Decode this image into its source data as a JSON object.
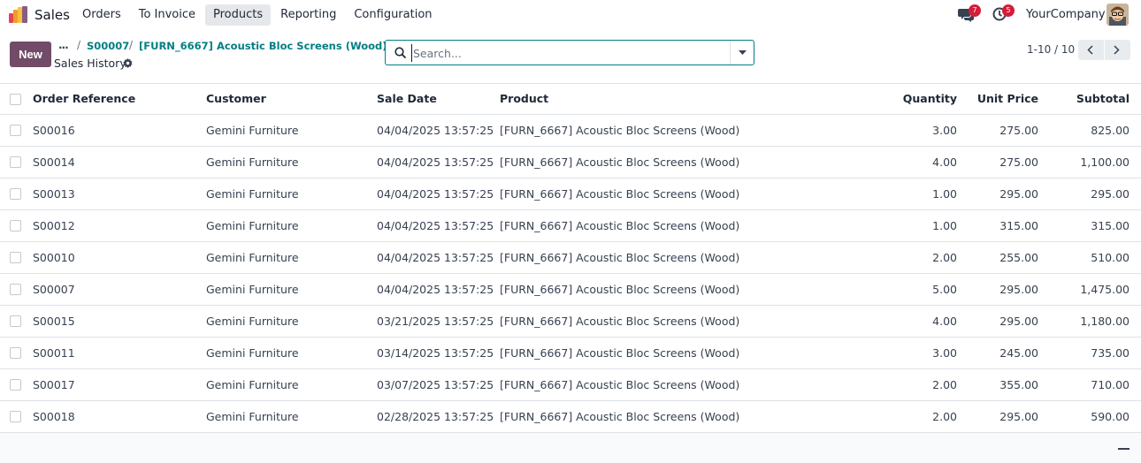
{
  "navbar": {
    "app_name": "Sales",
    "menu": [
      "Orders",
      "To Invoice",
      "Products",
      "Reporting",
      "Configuration"
    ],
    "active_menu": "Products",
    "messages_count": "7",
    "activities_count": "5",
    "company": "YourCompany"
  },
  "control": {
    "new_label": "New",
    "breadcrumb_ellipsis": "...",
    "breadcrumbs": [
      "S00007",
      "[FURN_6667] Acoustic Bloc Screens (Wood)"
    ],
    "page_title": "Sales History",
    "search_placeholder": "Search...",
    "pager": "1-10 / 10"
  },
  "table": {
    "columns": [
      "Order Reference",
      "Customer",
      "Sale Date",
      "Product",
      "Quantity",
      "Unit Price",
      "Subtotal"
    ],
    "rows": [
      [
        "S00016",
        "Gemini Furniture",
        "04/04/2025 13:57:25",
        "[FURN_6667] Acoustic Bloc Screens (Wood)",
        "3.00",
        "275.00",
        "825.00"
      ],
      [
        "S00014",
        "Gemini Furniture",
        "04/04/2025 13:57:25",
        "[FURN_6667] Acoustic Bloc Screens (Wood)",
        "4.00",
        "275.00",
        "1,100.00"
      ],
      [
        "S00013",
        "Gemini Furniture",
        "04/04/2025 13:57:25",
        "[FURN_6667] Acoustic Bloc Screens (Wood)",
        "1.00",
        "295.00",
        "295.00"
      ],
      [
        "S00012",
        "Gemini Furniture",
        "04/04/2025 13:57:25",
        "[FURN_6667] Acoustic Bloc Screens (Wood)",
        "1.00",
        "315.00",
        "315.00"
      ],
      [
        "S00010",
        "Gemini Furniture",
        "04/04/2025 13:57:25",
        "[FURN_6667] Acoustic Bloc Screens (Wood)",
        "2.00",
        "255.00",
        "510.00"
      ],
      [
        "S00007",
        "Gemini Furniture",
        "04/04/2025 13:57:25",
        "[FURN_6667] Acoustic Bloc Screens (Wood)",
        "5.00",
        "295.00",
        "1,475.00"
      ],
      [
        "S00015",
        "Gemini Furniture",
        "03/21/2025 13:57:25",
        "[FURN_6667] Acoustic Bloc Screens (Wood)",
        "4.00",
        "295.00",
        "1,180.00"
      ],
      [
        "S00011",
        "Gemini Furniture",
        "03/14/2025 13:57:25",
        "[FURN_6667] Acoustic Bloc Screens (Wood)",
        "3.00",
        "245.00",
        "735.00"
      ],
      [
        "S00017",
        "Gemini Furniture",
        "03/07/2025 13:57:25",
        "[FURN_6667] Acoustic Bloc Screens (Wood)",
        "2.00",
        "355.00",
        "710.00"
      ],
      [
        "S00018",
        "Gemini Furniture",
        "02/28/2025 13:57:25",
        "[FURN_6667] Acoustic Bloc Screens (Wood)",
        "2.00",
        "295.00",
        "590.00"
      ]
    ]
  },
  "colors": {
    "brand": "#714b67",
    "link": "#017e84",
    "badge": "#d21d3b"
  }
}
